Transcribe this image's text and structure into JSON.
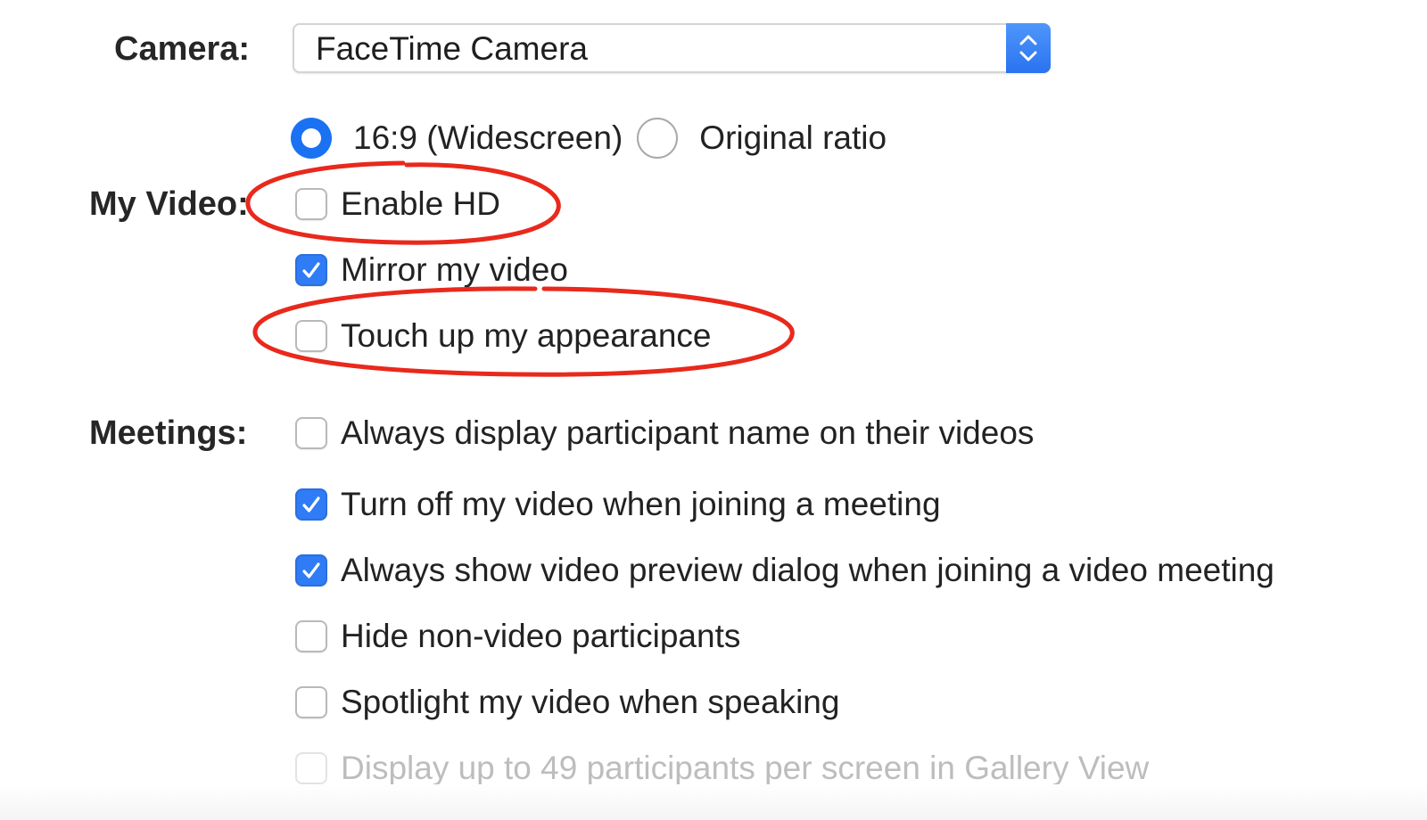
{
  "camera": {
    "label": "Camera:",
    "selected": "FaceTime Camera",
    "stepper_icon": "up-down-chevron-icon"
  },
  "aspect_ratio": {
    "options": [
      {
        "label": "16:9 (Widescreen)",
        "selected": true
      },
      {
        "label": "Original ratio",
        "selected": false
      }
    ]
  },
  "my_video": {
    "label": "My Video:",
    "options": [
      {
        "label": "Enable HD",
        "checked": false
      },
      {
        "label": "Mirror my video",
        "checked": true
      },
      {
        "label": "Touch up my appearance",
        "checked": false
      }
    ]
  },
  "meetings": {
    "label": "Meetings:",
    "options": [
      {
        "label": "Always display participant name on their videos",
        "checked": false
      },
      {
        "label": "Turn off my video when joining a meeting",
        "checked": true
      },
      {
        "label": "Always show video preview dialog when joining a video meeting",
        "checked": true
      },
      {
        "label": "Hide non-video participants",
        "checked": false
      },
      {
        "label": "Spotlight my video when speaking",
        "checked": false
      },
      {
        "label": "Display up to 49 participants per screen in Gallery View",
        "checked": false,
        "disabled": true
      }
    ]
  },
  "colors": {
    "accent": "#2f7cf6",
    "annotation": "#e8291c",
    "disabled_text": "#bdbdbd"
  }
}
